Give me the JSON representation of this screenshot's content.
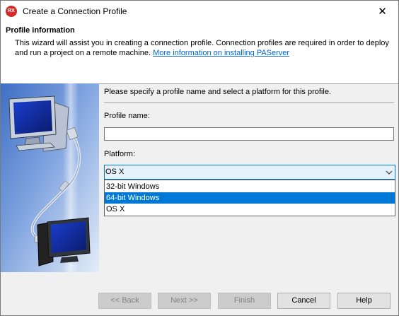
{
  "window": {
    "title": "Create a Connection Profile",
    "app_icon_text": "RX",
    "close_glyph": "✕"
  },
  "header": {
    "title": "Profile information",
    "description": "This wizard will assist you in creating a connection profile.  Connection profiles are required in order to deploy and run a project on a remote machine.",
    "link_text": "More information on installing PAServer"
  },
  "content": {
    "intro": "Please specify a profile name and select a platform for this profile.",
    "profile_name_label": "Profile name:",
    "profile_name_value": "",
    "platform_label": "Platform:",
    "platform_selected": "OS X",
    "platform_options": [
      "32-bit Windows",
      "64-bit Windows",
      "OS X"
    ],
    "highlighted_option": "64-bit Windows"
  },
  "buttons": {
    "back": "<< Back",
    "next": "Next >>",
    "finish": "Finish",
    "cancel": "Cancel",
    "help": "Help"
  },
  "colors": {
    "accent": "#0078d7",
    "link": "#0066cc",
    "side_panel_gradient_top": "#4a78c8",
    "side_panel_gradient_bottom": "#dfe8f6"
  }
}
